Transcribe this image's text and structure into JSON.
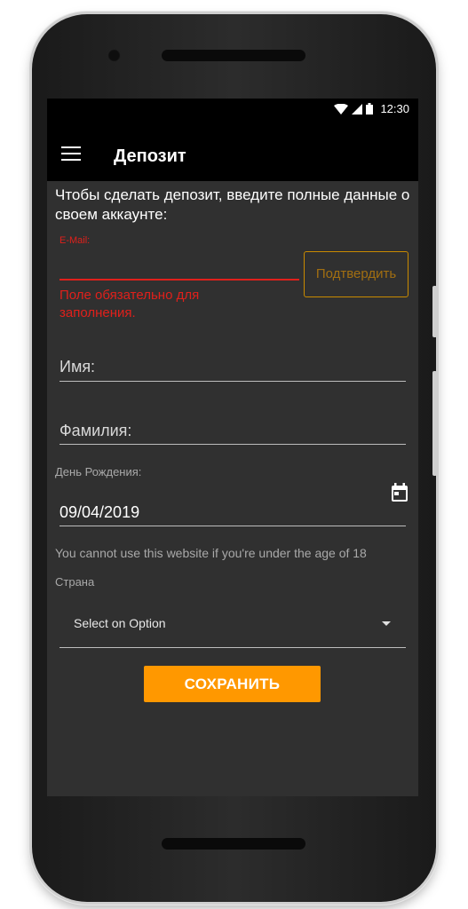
{
  "status_bar": {
    "time": "12:30"
  },
  "toolbar": {
    "title": "Депозит",
    "menu_icon": "hamburger-menu-icon"
  },
  "form": {
    "intro": "Чтобы сделать депозит, введите полные данные о своем аккаунте:",
    "email": {
      "label": "E-Mail:",
      "value": "",
      "error": "Поле обязательно для заполнения.",
      "error_color": "#e0201b"
    },
    "confirm_button": "Подтвердить",
    "first_name": {
      "placeholder": "Имя:"
    },
    "last_name": {
      "placeholder": "Фамилия:"
    },
    "birthday": {
      "label": "День Рождения:",
      "value": "09/04/2019",
      "icon": "calendar-icon"
    },
    "age_notice": "You cannot use this website if you're under the age of 18",
    "country": {
      "label": "Страна",
      "selected": "Select on Option"
    },
    "save_button": "СОХРАНИТЬ"
  },
  "colors": {
    "accent": "#ff9800",
    "background": "#303030",
    "bar": "#000000"
  }
}
